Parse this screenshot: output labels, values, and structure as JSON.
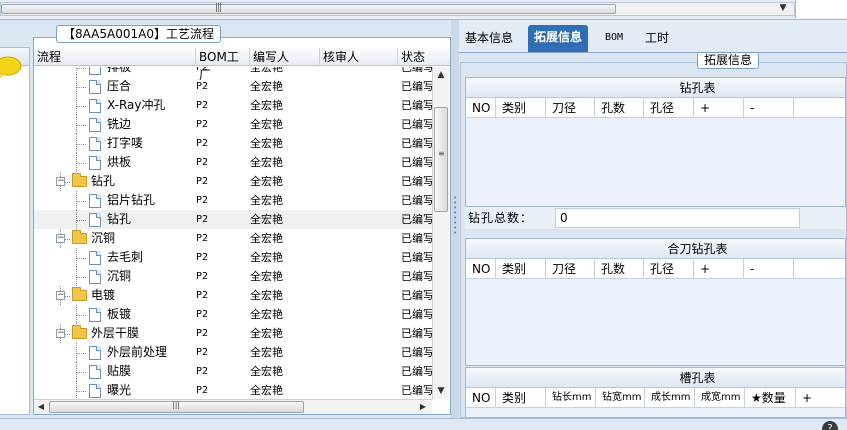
{
  "top_scroll": {
    "grip": "|||",
    "arrow": "▼"
  },
  "tree_panel": {
    "tab_title": "【8AA5A001A0】工艺流程",
    "columns": [
      "流程",
      "BOM工厂",
      "编写人",
      "核审人",
      "状态"
    ],
    "rows": [
      {
        "name": "排板",
        "type": "doc",
        "bom": "P2",
        "writer": "全宏艳",
        "status": "已编写"
      },
      {
        "name": "压合",
        "type": "doc",
        "bom": "P2",
        "writer": "全宏艳",
        "status": "已编写"
      },
      {
        "name": "X-Ray冲孔",
        "type": "doc",
        "bom": "P2",
        "writer": "全宏艳",
        "status": "已编写"
      },
      {
        "name": "铣边",
        "type": "doc",
        "bom": "P2",
        "writer": "全宏艳",
        "status": "已编写"
      },
      {
        "name": "打字唛",
        "type": "doc",
        "bom": "P2",
        "writer": "全宏艳",
        "status": "已编写"
      },
      {
        "name": "烘板",
        "type": "doc",
        "bom": "P2",
        "writer": "全宏艳",
        "status": "已编写"
      },
      {
        "name": "钻孔",
        "type": "folder",
        "bom": "P2",
        "writer": "全宏艳",
        "status": "已编写"
      },
      {
        "name": "铝片钻孔",
        "type": "doc",
        "bom": "P2",
        "writer": "全宏艳",
        "status": "已编写"
      },
      {
        "name": "钻孔",
        "type": "doc",
        "bom": "P2",
        "writer": "全宏艳",
        "status": "已编写",
        "selected": true
      },
      {
        "name": "沉铜",
        "type": "folder",
        "bom": "P2",
        "writer": "全宏艳",
        "status": "已编写"
      },
      {
        "name": "去毛刺",
        "type": "doc",
        "bom": "P2",
        "writer": "全宏艳",
        "status": "已编写"
      },
      {
        "name": "沉铜",
        "type": "doc",
        "bom": "P2",
        "writer": "全宏艳",
        "status": "已编写"
      },
      {
        "name": "电镀",
        "type": "folder",
        "bom": "P2",
        "writer": "全宏艳",
        "status": "已编写"
      },
      {
        "name": "板镀",
        "type": "doc",
        "bom": "P2",
        "writer": "全宏艳",
        "status": "已编写"
      },
      {
        "name": "外层干膜",
        "type": "folder",
        "bom": "P2",
        "writer": "全宏艳",
        "status": "已编写"
      },
      {
        "name": "外层前处理",
        "type": "doc",
        "bom": "P2",
        "writer": "全宏艳",
        "status": "已编写"
      },
      {
        "name": "贴膜",
        "type": "doc",
        "bom": "P2",
        "writer": "全宏艳",
        "status": "已编写"
      },
      {
        "name": "曝光",
        "type": "doc",
        "bom": "P2",
        "writer": "全宏艳",
        "status": "已编写"
      }
    ],
    "scroll_up": "▲",
    "scroll_down": "▼",
    "scroll_left": "◀",
    "scroll_right": "▶",
    "scroll_grip": "|||"
  },
  "right_panel": {
    "tabs": [
      "基本信息",
      "拓展信息",
      "BOM",
      "工时"
    ],
    "active_tab": 1,
    "group_title": "拓展信息",
    "drill_table": {
      "caption": "钻孔表",
      "columns": [
        "NO",
        "类别",
        "刀径",
        "孔数",
        "孔径",
        "+",
        "-"
      ]
    },
    "drill_total": {
      "label": "钻孔总数：",
      "value": "0"
    },
    "combo_table": {
      "caption": "合刀钻孔表",
      "columns": [
        "NO",
        "类别",
        "刀径",
        "孔数",
        "孔径",
        "+",
        "-"
      ]
    },
    "slot_table": {
      "caption": "槽孔表",
      "columns": [
        "NO",
        "类别",
        "钻长mm",
        "钻宽mm",
        "成长mm",
        "成宽mm",
        "★数量",
        "+"
      ]
    }
  },
  "colors": {
    "accent": "#2f6eb5",
    "panel_bg": "#dbe6f3",
    "table_bg": "#eaf1fa",
    "folder": "#f1c64b"
  }
}
